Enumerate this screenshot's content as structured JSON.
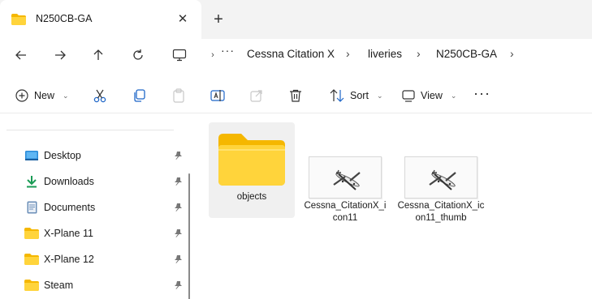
{
  "window": {
    "tab_title": "N250CB-GA",
    "tab_icon": "folder-icon",
    "close_glyph": "✕",
    "new_tab_glyph": "+"
  },
  "nav": {
    "more_glyph": "···",
    "breadcrumb": [
      "Cessna Citation X",
      "liveries",
      "N250CB-GA"
    ],
    "separator": "›"
  },
  "toolbar": {
    "new_label": "New",
    "sort_label": "Sort",
    "view_label": "View",
    "more_glyph": "···"
  },
  "sidebar": {
    "items": [
      {
        "label": "Desktop",
        "icon": "desktop-icon"
      },
      {
        "label": "Downloads",
        "icon": "download-icon"
      },
      {
        "label": "Documents",
        "icon": "documents-icon"
      },
      {
        "label": "X-Plane 11",
        "icon": "folder-icon"
      },
      {
        "label": "X-Plane 12",
        "icon": "folder-icon"
      },
      {
        "label": "Steam",
        "icon": "folder-icon"
      }
    ]
  },
  "files": [
    {
      "name": "objects",
      "type": "folder"
    },
    {
      "name": "Cessna_CitationX_icon11",
      "type": "image"
    },
    {
      "name": "Cessna_CitationX_icon11_thumb",
      "type": "image"
    }
  ],
  "colors": {
    "folder_yellow": "#ffd43b",
    "folder_back": "#f5b700",
    "accent_blue": "#0067c0",
    "download_green": "#1a9b55"
  }
}
